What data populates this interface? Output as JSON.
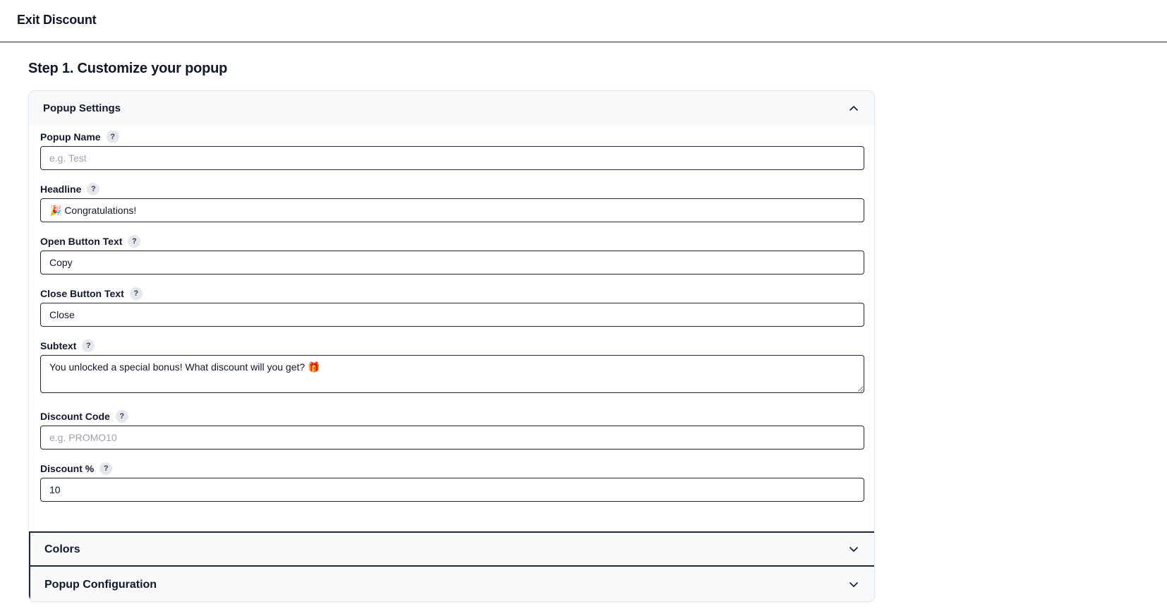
{
  "header": {
    "title": "Exit Discount"
  },
  "step": {
    "title": "Step 1. Customize your popup"
  },
  "sections": {
    "popup_settings": {
      "title": "Popup Settings",
      "expanded": true,
      "icon": "chevron-up-icon"
    },
    "colors": {
      "title": "Colors",
      "expanded": false,
      "icon": "chevron-down-icon"
    },
    "popup_configuration": {
      "title": "Popup Configuration",
      "expanded": false,
      "icon": "chevron-down-icon"
    }
  },
  "help_glyph": "?",
  "fields": {
    "popup_name": {
      "label": "Popup Name",
      "value": "",
      "placeholder": "e.g. Test"
    },
    "headline": {
      "label": "Headline",
      "value": "🎉 Congratulations!",
      "placeholder": ""
    },
    "open_button_text": {
      "label": "Open Button Text",
      "value": "Copy",
      "placeholder": ""
    },
    "close_button_text": {
      "label": "Close Button Text",
      "value": "Close",
      "placeholder": ""
    },
    "subtext": {
      "label": "Subtext",
      "value": "You unlocked a special bonus! What discount will you get? 🎁",
      "placeholder": ""
    },
    "discount_code": {
      "label": "Discount Code",
      "value": "",
      "placeholder": "e.g. PROMO10"
    },
    "discount_percent": {
      "label": "Discount %",
      "value": "10",
      "placeholder": ""
    }
  }
}
